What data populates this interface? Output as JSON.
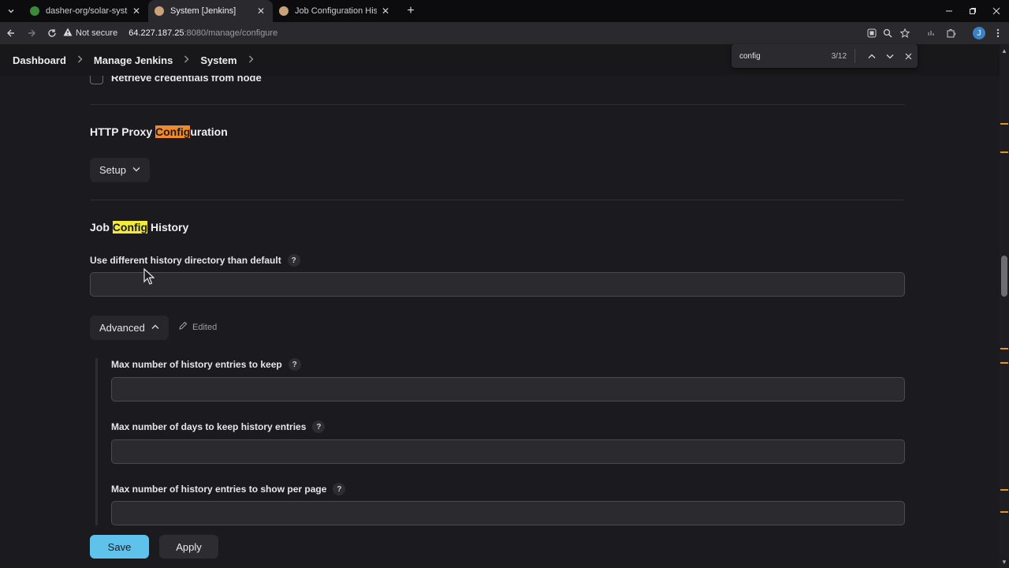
{
  "browser": {
    "tabs": [
      {
        "title": "dasher-org/solar-system - solar",
        "favicon_color": "#3a8a3a"
      },
      {
        "title": "System [Jenkins]",
        "favicon_color": "#c9a27a"
      },
      {
        "title": "Job Configuration History | Jenkins",
        "favicon_color": "#c9a27a"
      }
    ],
    "new_tab_glyph": "+",
    "address": {
      "security_label": "Not secure",
      "host": "64.227.187.25",
      "path": ":8080/manage/configure"
    },
    "profile_initial": "J"
  },
  "breadcrumb": {
    "items": [
      "Dashboard",
      "Manage Jenkins",
      "System"
    ]
  },
  "find": {
    "query": "config",
    "count": "3/12"
  },
  "page": {
    "checkbox_label": "Retrieve credentials from node",
    "proxy_section": {
      "title_before": "HTTP Proxy ",
      "title_match": "Config",
      "title_after": "uration",
      "setup_label": "Setup"
    },
    "history_section": {
      "title_before": "Job ",
      "title_match": "Config",
      "title_after": " History",
      "dir_label": "Use different history directory than default",
      "dir_value": "",
      "advanced_label": "Advanced",
      "edited_label": "Edited",
      "max_entries_label": "Max number of history entries to keep",
      "max_entries_value": "",
      "max_days_label": "Max number of days to keep history entries",
      "max_days_value": "",
      "per_page_label": "Max number of history entries to show per page",
      "per_page_value": ""
    },
    "help_glyph": "?"
  },
  "actions": {
    "save_label": "Save",
    "apply_label": "Apply"
  },
  "colors": {
    "accent_save": "#5fc2ea",
    "find_current_match": "#f08a2b",
    "find_other_match": "#f4ea3a"
  }
}
